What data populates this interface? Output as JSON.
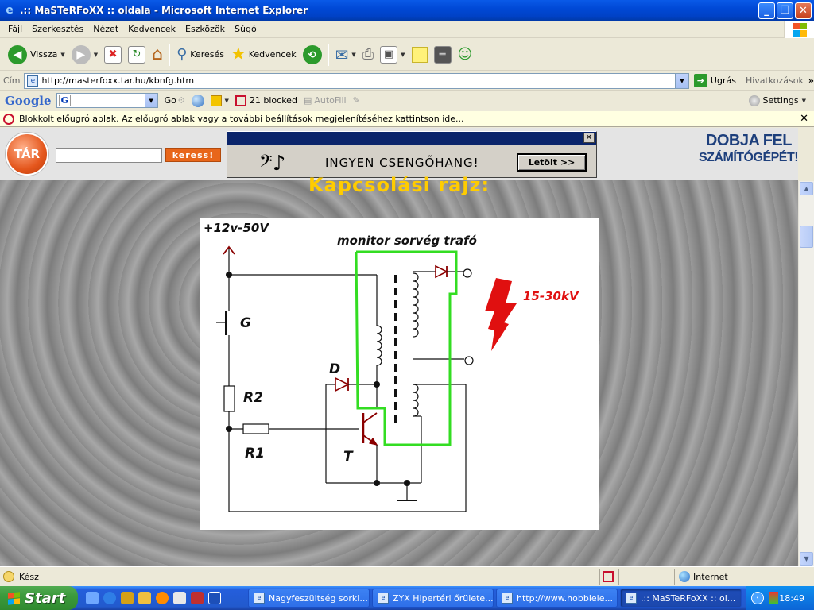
{
  "window": {
    "title": ".:: MaSTeRFoXX :: oldala - Microsoft Internet Explorer",
    "minimize": "_",
    "maximize": "❐",
    "close": "✕"
  },
  "menu": [
    "Fájl",
    "Szerkesztés",
    "Nézet",
    "Kedvencek",
    "Eszközök",
    "Súgó"
  ],
  "toolbar": {
    "back_label": "Vissza",
    "search_label": "Keresés",
    "favorites_label": "Kedvencek"
  },
  "address": {
    "label": "Cím",
    "url": "http://masterfoxx.tar.hu/kbnfg.htm",
    "go_label": "Ugrás",
    "links_label": "Hivatkozások",
    "links_chevron": "»"
  },
  "google_bar": {
    "logo": "Google",
    "search_prefix": "G",
    "go_label": "Go",
    "blocked": "21 blocked",
    "autofill": "AutoFill",
    "settings": "Settings"
  },
  "info_bar": {
    "text": "Blokkolt előugró ablak. Az előugró ablak vagy a további beállítások megjelenítéséhez kattintson ide...",
    "close": "✕"
  },
  "site": {
    "logo_text": "TÁR",
    "search_button": "keress!",
    "ad_text": "INGYEN CSENGŐHANG!",
    "ad_button": "Letölt >>",
    "ad_close": "✕",
    "ad_note": "𝄢♪",
    "promo_line1": "DOBJA FEL",
    "promo_line2": "SZÁMÍTÓGÉPÉT!",
    "page_title": "Kapcsolási rajz:"
  },
  "diagram": {
    "supply_label": "+12v-50V",
    "transformer_label": "monitor sorvég trafó",
    "voltage_label": "15-30kV",
    "g_label": "G",
    "r2_label": "R2",
    "r1_label": "R1",
    "d_label": "D",
    "t_label": "T"
  },
  "status": {
    "text": "Kész",
    "zone": "Internet"
  },
  "taskbar": {
    "start": "Start",
    "tasks": [
      "Nagyfeszültség sorki...",
      "ZYX Hipertéri őrülete...",
      "http://www.hobbiele...",
      ".:: MaSTeRFoXX :: ol..."
    ],
    "clock": "18:49"
  },
  "colors": {
    "title_bar": "#0054e3",
    "page_title": "#ffcc00",
    "ad_button_accent": "#e8661a",
    "diagram_green": "#33dd22",
    "diagram_red": "#e01010",
    "diagram_dark_red": "#8b0000"
  }
}
